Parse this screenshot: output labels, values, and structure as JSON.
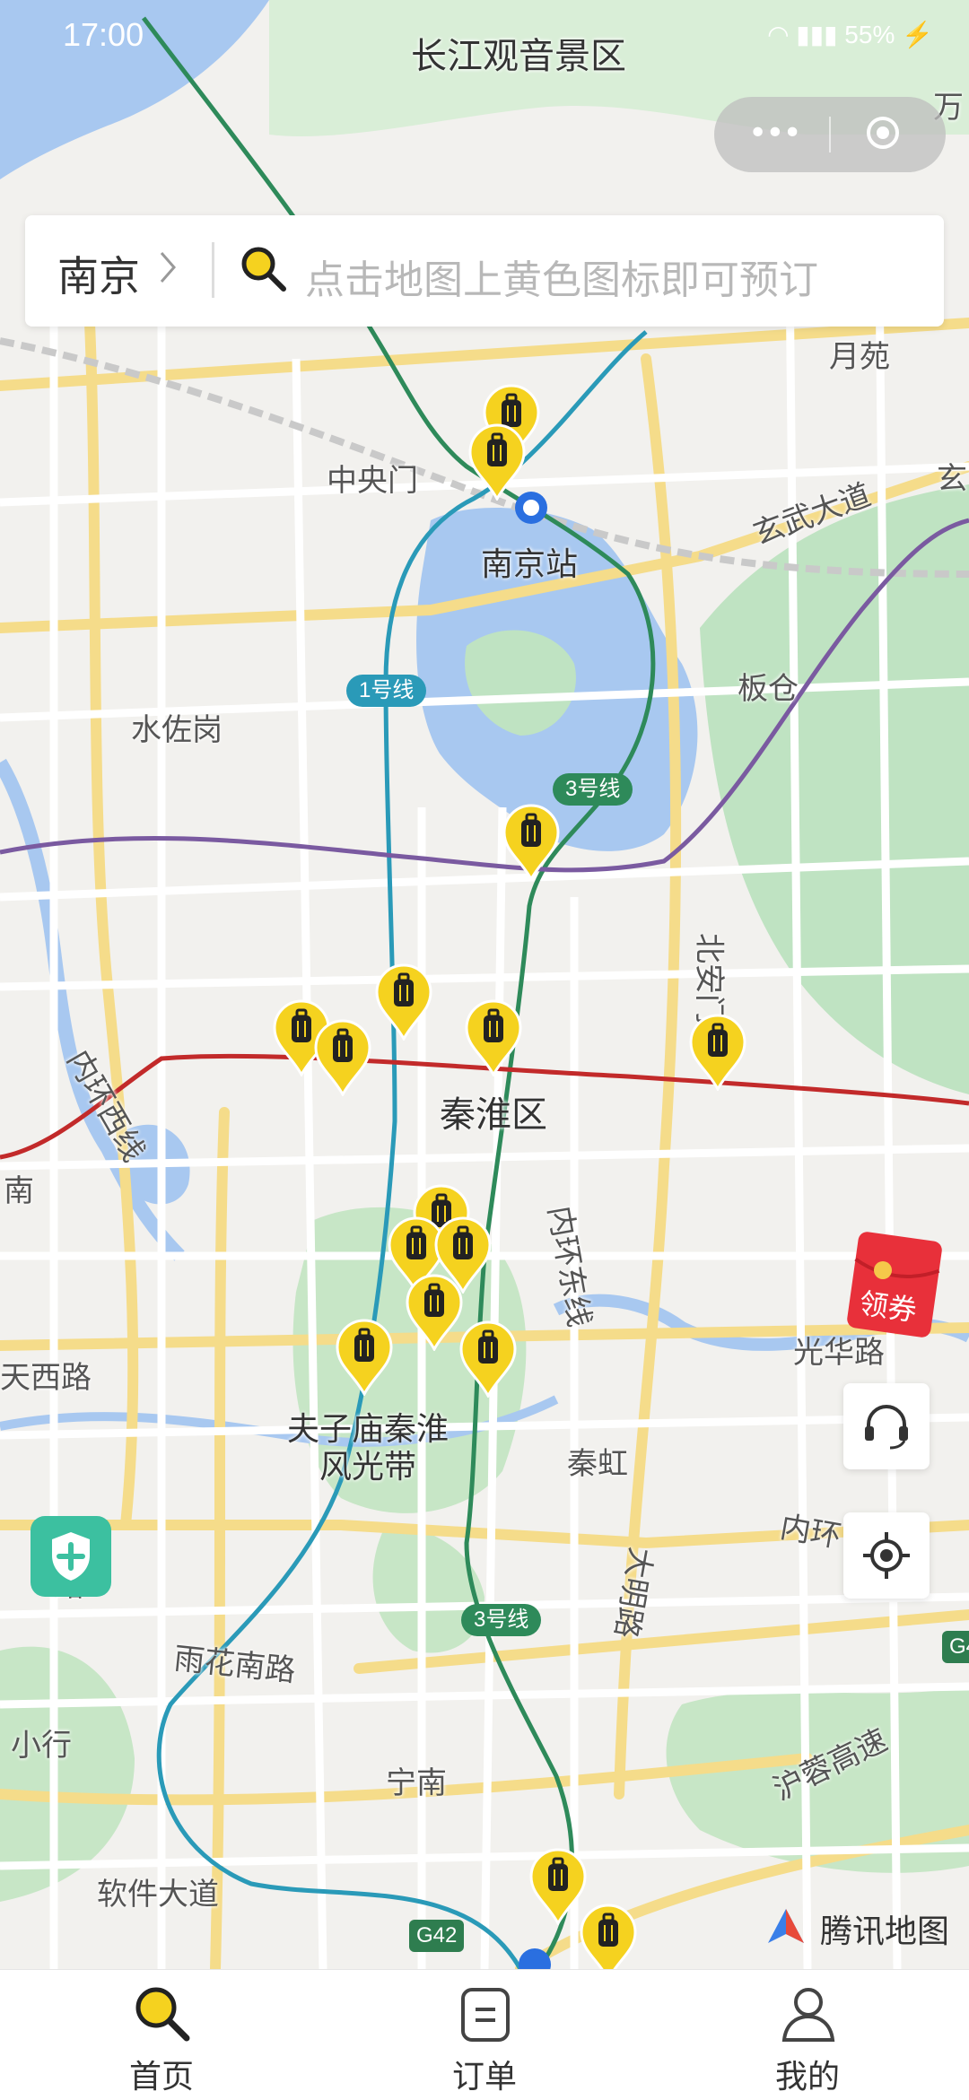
{
  "status_bar": {
    "time": "17:00",
    "battery": "55%"
  },
  "search": {
    "city": "南京",
    "placeholder": "点击地图上黄色图标即可预订"
  },
  "map": {
    "labels": {
      "scenic_area": "长江观音景区",
      "yuanyuan": "月苑",
      "zhongyangmen": "中央门",
      "nanjing_station": "南京站",
      "xuanwu_road": "玄武大道",
      "bancang": "板仓",
      "shuizuogang": "水佐岗",
      "beianmen_street": "北安门街",
      "ring_road": "内环西线",
      "qinhuai_district": "秦淮区",
      "inner_ring_east": "内环东线",
      "ring_south": "南",
      "tianxi_road": "天西路",
      "guanghua_road": "光华路",
      "fuzimiao": "夫子庙秦淮",
      "fengguangdai": "风光带",
      "qinhong": "秦虹",
      "inner_ring": "内环",
      "daming_road": "大明路",
      "yuhua_south_road": "雨花南路",
      "xiaohang": "小行",
      "ningnan": "宁南",
      "hurong_highway": "沪蓉高速",
      "ruanjian_avenue": "软件大道",
      "g42": "G42",
      "g4": "G4",
      "wan": "万",
      "kuai": "玄",
      "shenlu": "路"
    },
    "metro_badges": {
      "line1": "1号线",
      "line3a": "3号线",
      "line3b": "3号线"
    },
    "provider": "腾讯地图",
    "coupon_label": "领券"
  },
  "tabs": [
    {
      "label": "首页"
    },
    {
      "label": "订单"
    },
    {
      "label": "我的"
    }
  ],
  "colors": {
    "accent": "#f5d21f",
    "pin_dark": "#222222",
    "line1": "#2a9ab8",
    "line3": "#2e8a5a",
    "line2": "#c22a2a",
    "line4": "#7a5aa0",
    "water": "#a8c8f0",
    "park": "#bfe3c2"
  }
}
